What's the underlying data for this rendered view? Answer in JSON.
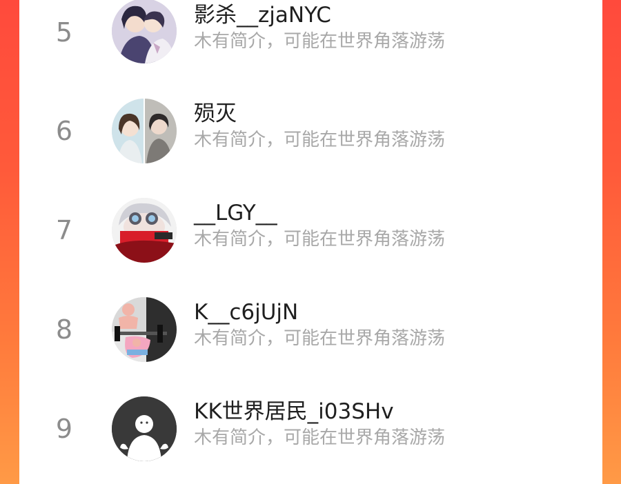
{
  "colors": {
    "background_top": "#ff4a3c",
    "background_bottom": "#ff9a46",
    "card": "#ffffff",
    "rank_text": "#8c8c8c",
    "name_text": "#1f1f1f",
    "desc_text": "#a8a8a8"
  },
  "list": {
    "items": [
      {
        "rank": "5",
        "name": "影杀__zjaNYC",
        "desc": "木有简介，可能在世界角落游荡",
        "avatar": "anime-couple-avatar"
      },
      {
        "rank": "6",
        "name": "殒灭",
        "desc": "木有简介，可能在世界角落游荡",
        "avatar": "anime-split-avatar"
      },
      {
        "rank": "7",
        "name": "__LGY__",
        "desc": "木有简介，可能在世界角落游荡",
        "avatar": "masked-character-avatar"
      },
      {
        "rank": "8",
        "name": "K__c6jUjN",
        "desc": "木有简介，可能在世界角落游荡",
        "avatar": "weightlifting-cartoon-avatar"
      },
      {
        "rank": "9",
        "name": "KK世界居民_i03SHv",
        "desc": "木有简介，可能在世界角落游荡",
        "avatar": "default-person-avatar"
      }
    ]
  }
}
